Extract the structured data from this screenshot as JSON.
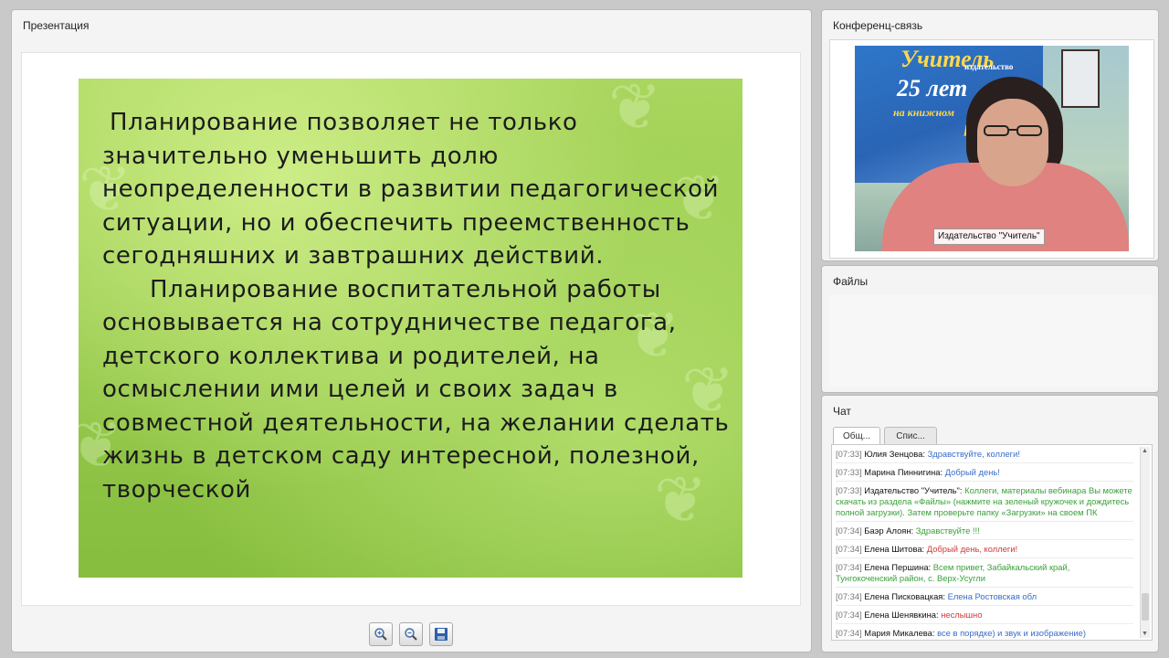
{
  "presentation": {
    "title": "Презентация",
    "slide": {
      "paragraph1": "Планирование позволяет не только значительно уменьшить долю неопределенности в развитии педагогической ситуации, но и обеспечить преемственность сегодняшних и завтрашних действий.",
      "paragraph2": "Планирование воспитательной работы основывается на сотрудничестве педагога, детского коллектива и родителей, на осмыслении ими целей и своих задач в совместной деятельности, на желании сделать жизнь в детском саду интересной, полезной, творческой"
    },
    "toolbar": {
      "zoom_in_icon": "zoom-in-icon",
      "zoom_out_icon": "zoom-out-icon",
      "save_icon": "save-icon"
    }
  },
  "conference": {
    "title": "Конференц-связь",
    "banner_line1": "Учитель",
    "banner_line2": "издательство",
    "banner_line3": "25 лет",
    "banner_line4": "на книжном",
    "banner_line5": "ро",
    "speaker_label": "Издательство \"Учитель\""
  },
  "files": {
    "title": "Файлы"
  },
  "chat": {
    "title": "Чат",
    "tabs": [
      "Общ...",
      "Спис..."
    ],
    "messages": [
      {
        "time": "[07:33]",
        "name": "Юлия Зенцова:",
        "text": "Здравствуйте, коллеги!",
        "color": "blue"
      },
      {
        "time": "[07:33]",
        "name": "Марина Пиннигина:",
        "text": "Добрый день!",
        "color": "blue"
      },
      {
        "time": "[07:33]",
        "name": "Издательство \"Учитель\":",
        "text": "Коллеги, материалы вебинара Вы можете скачать из раздела «Файлы» (нажмите на зеленый кружочек и дождитесь полной загрузки). Затем проверьте папку «Загрузки» на своем ПК",
        "color": "green"
      },
      {
        "time": "[07:34]",
        "name": "Баэр Алоян:",
        "text": "Здравствуйте !!!",
        "color": "green"
      },
      {
        "time": "[07:34]",
        "name": "Елена Шитова:",
        "text": "Добрый день, коллеги!",
        "color": "red"
      },
      {
        "time": "[07:34]",
        "name": "Елена Першина:",
        "text": "Всем привет, Забайкальский край, Тунгокоченский район, с. Верх-Усугли",
        "color": "green"
      },
      {
        "time": "[07:34]",
        "name": "Елена Писковацкая:",
        "text": "Елена Ростовская обл",
        "color": "blue"
      },
      {
        "time": "[07:34]",
        "name": "Елена Шенявкина:",
        "text": "неслышно",
        "color": "red"
      },
      {
        "time": "[07:34]",
        "name": "Мария Микалева:",
        "text": "все в порядке) и звук и изображение)",
        "color": "blue"
      }
    ]
  },
  "colors": {
    "panel_bg": "#f4f4f4",
    "slide_green": "#9ccf52",
    "chat_green": "#3aa03a",
    "chat_blue": "#3a6cc8",
    "chat_red": "#d03a3a"
  }
}
